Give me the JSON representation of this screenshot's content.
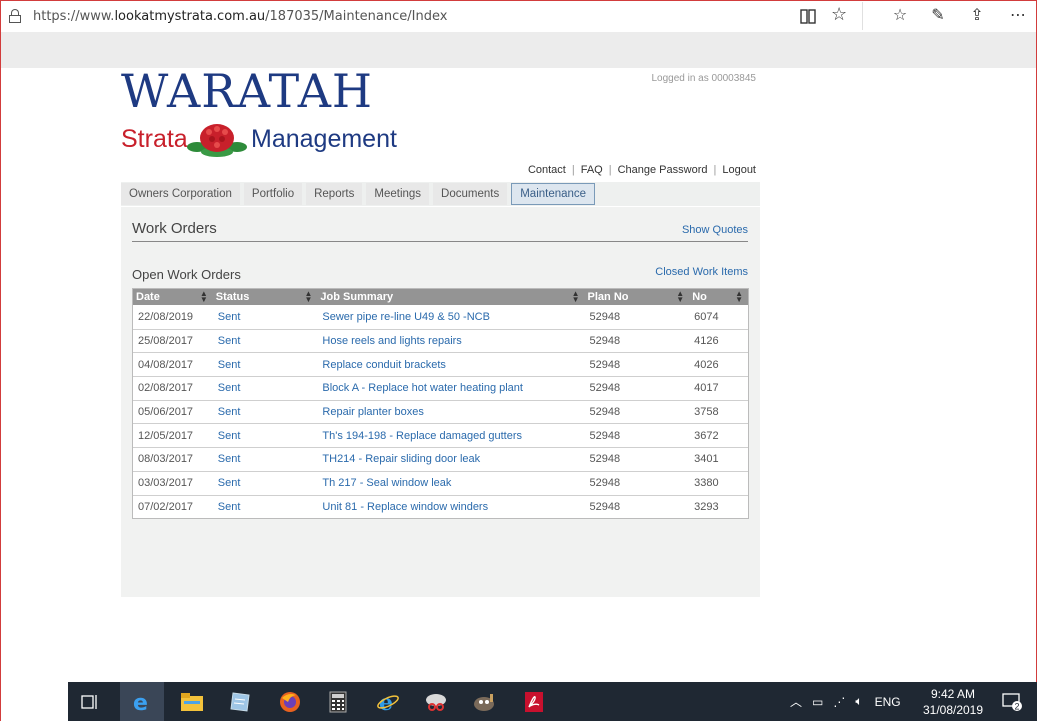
{
  "browser": {
    "url_prefix": "https://www.",
    "url_domain": "lookatmystrata.com.au",
    "url_path": "/187035/Maintenance/Index"
  },
  "logo": {
    "line1": "WARATAH",
    "strata": "Strata",
    "management": "Management"
  },
  "header": {
    "logged_in": "Logged in as 00003845",
    "links": [
      "Contact",
      "FAQ",
      "Change Password",
      "Logout"
    ]
  },
  "nav": {
    "tabs": [
      "Owners Corporation",
      "Portfolio",
      "Reports",
      "Meetings",
      "Documents",
      "Maintenance"
    ],
    "active": "Maintenance"
  },
  "panel": {
    "title": "Work Orders",
    "show_quotes": "Show Quotes",
    "subtitle": "Open Work Orders",
    "closed_items": "Closed Work Items"
  },
  "table": {
    "headers": [
      "Date",
      "Status",
      "Job Summary",
      "Plan No",
      "No"
    ],
    "rows": [
      [
        "22/08/2019",
        "Sent",
        "Sewer pipe re-line U49 & 50 -NCB",
        "52948",
        "6074"
      ],
      [
        "25/08/2017",
        "Sent",
        "Hose reels and lights repairs",
        "52948",
        "4126"
      ],
      [
        "04/08/2017",
        "Sent",
        "Replace conduit brackets",
        "52948",
        "4026"
      ],
      [
        "02/08/2017",
        "Sent",
        "Block A - Replace hot water heating plant",
        "52948",
        "4017"
      ],
      [
        "05/06/2017",
        "Sent",
        "Repair planter boxes",
        "52948",
        "3758"
      ],
      [
        "12/05/2017",
        "Sent",
        "Th's 194-198 - Replace damaged gutters",
        "52948",
        "3672"
      ],
      [
        "08/03/2017",
        "Sent",
        "TH214 - Repair sliding door leak",
        "52948",
        "3401"
      ],
      [
        "03/03/2017",
        "Sent",
        "Th 217 - Seal window leak",
        "52948",
        "3380"
      ],
      [
        "07/02/2017",
        "Sent",
        "Unit 81 - Replace window winders",
        "52948",
        "3293"
      ]
    ]
  },
  "taskbar": {
    "lang": "ENG",
    "time": "9:42 AM",
    "date": "31/08/2019",
    "notifications": "2"
  }
}
